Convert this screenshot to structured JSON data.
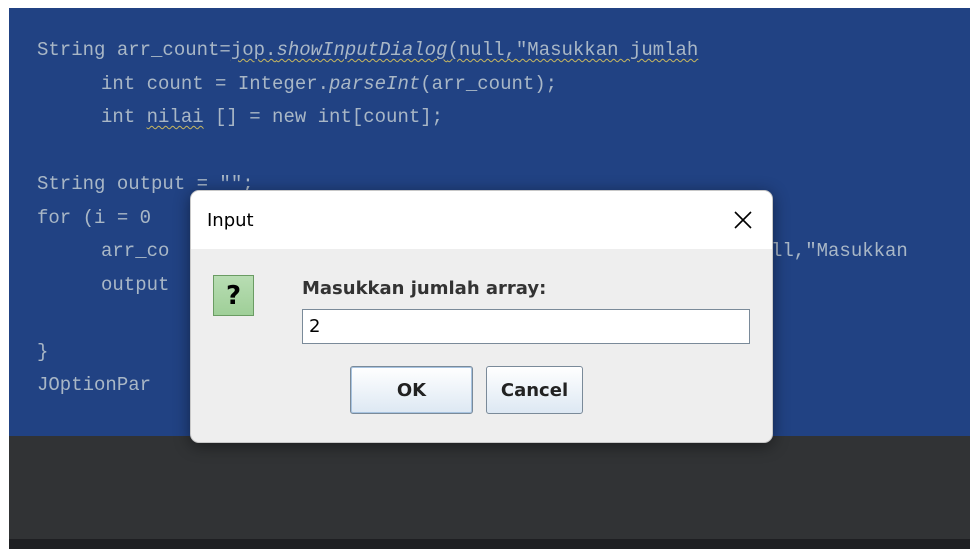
{
  "editor": {
    "lines": [
      {
        "pre": "String arr_count=",
        "link": "jop.",
        "ital": "showInputDialog",
        "post": "(null,\"Masukkan jumlah"
      },
      {
        "pre": "int count = Integer.",
        "ital": "parseInt",
        "post": "(arr_count);"
      },
      {
        "pre": "int ",
        "squig": "nilai",
        "post": " [] = new int[count];"
      },
      {
        "text": ""
      },
      {
        "text": "String output = \"\";"
      },
      {
        "text": "for (i = 0"
      },
      {
        "text": "arr_co",
        "right": "ll,\"Masukkan"
      },
      {
        "text": "output"
      },
      {
        "text": ""
      },
      {
        "text": "}"
      },
      {
        "text": "JOptionPar"
      }
    ]
  },
  "dialog": {
    "title": "Input",
    "close_glyph": "✕",
    "icon_glyph": "?",
    "message": "Masukkan jumlah array:",
    "input_value": "2",
    "ok_label": "OK",
    "cancel_label": "Cancel"
  },
  "colors": {
    "editor_bg": "#214283",
    "code_text": "#a9b7c6",
    "dialog_bg": "#eeeeee",
    "icon_bg": "#9fcf98"
  }
}
